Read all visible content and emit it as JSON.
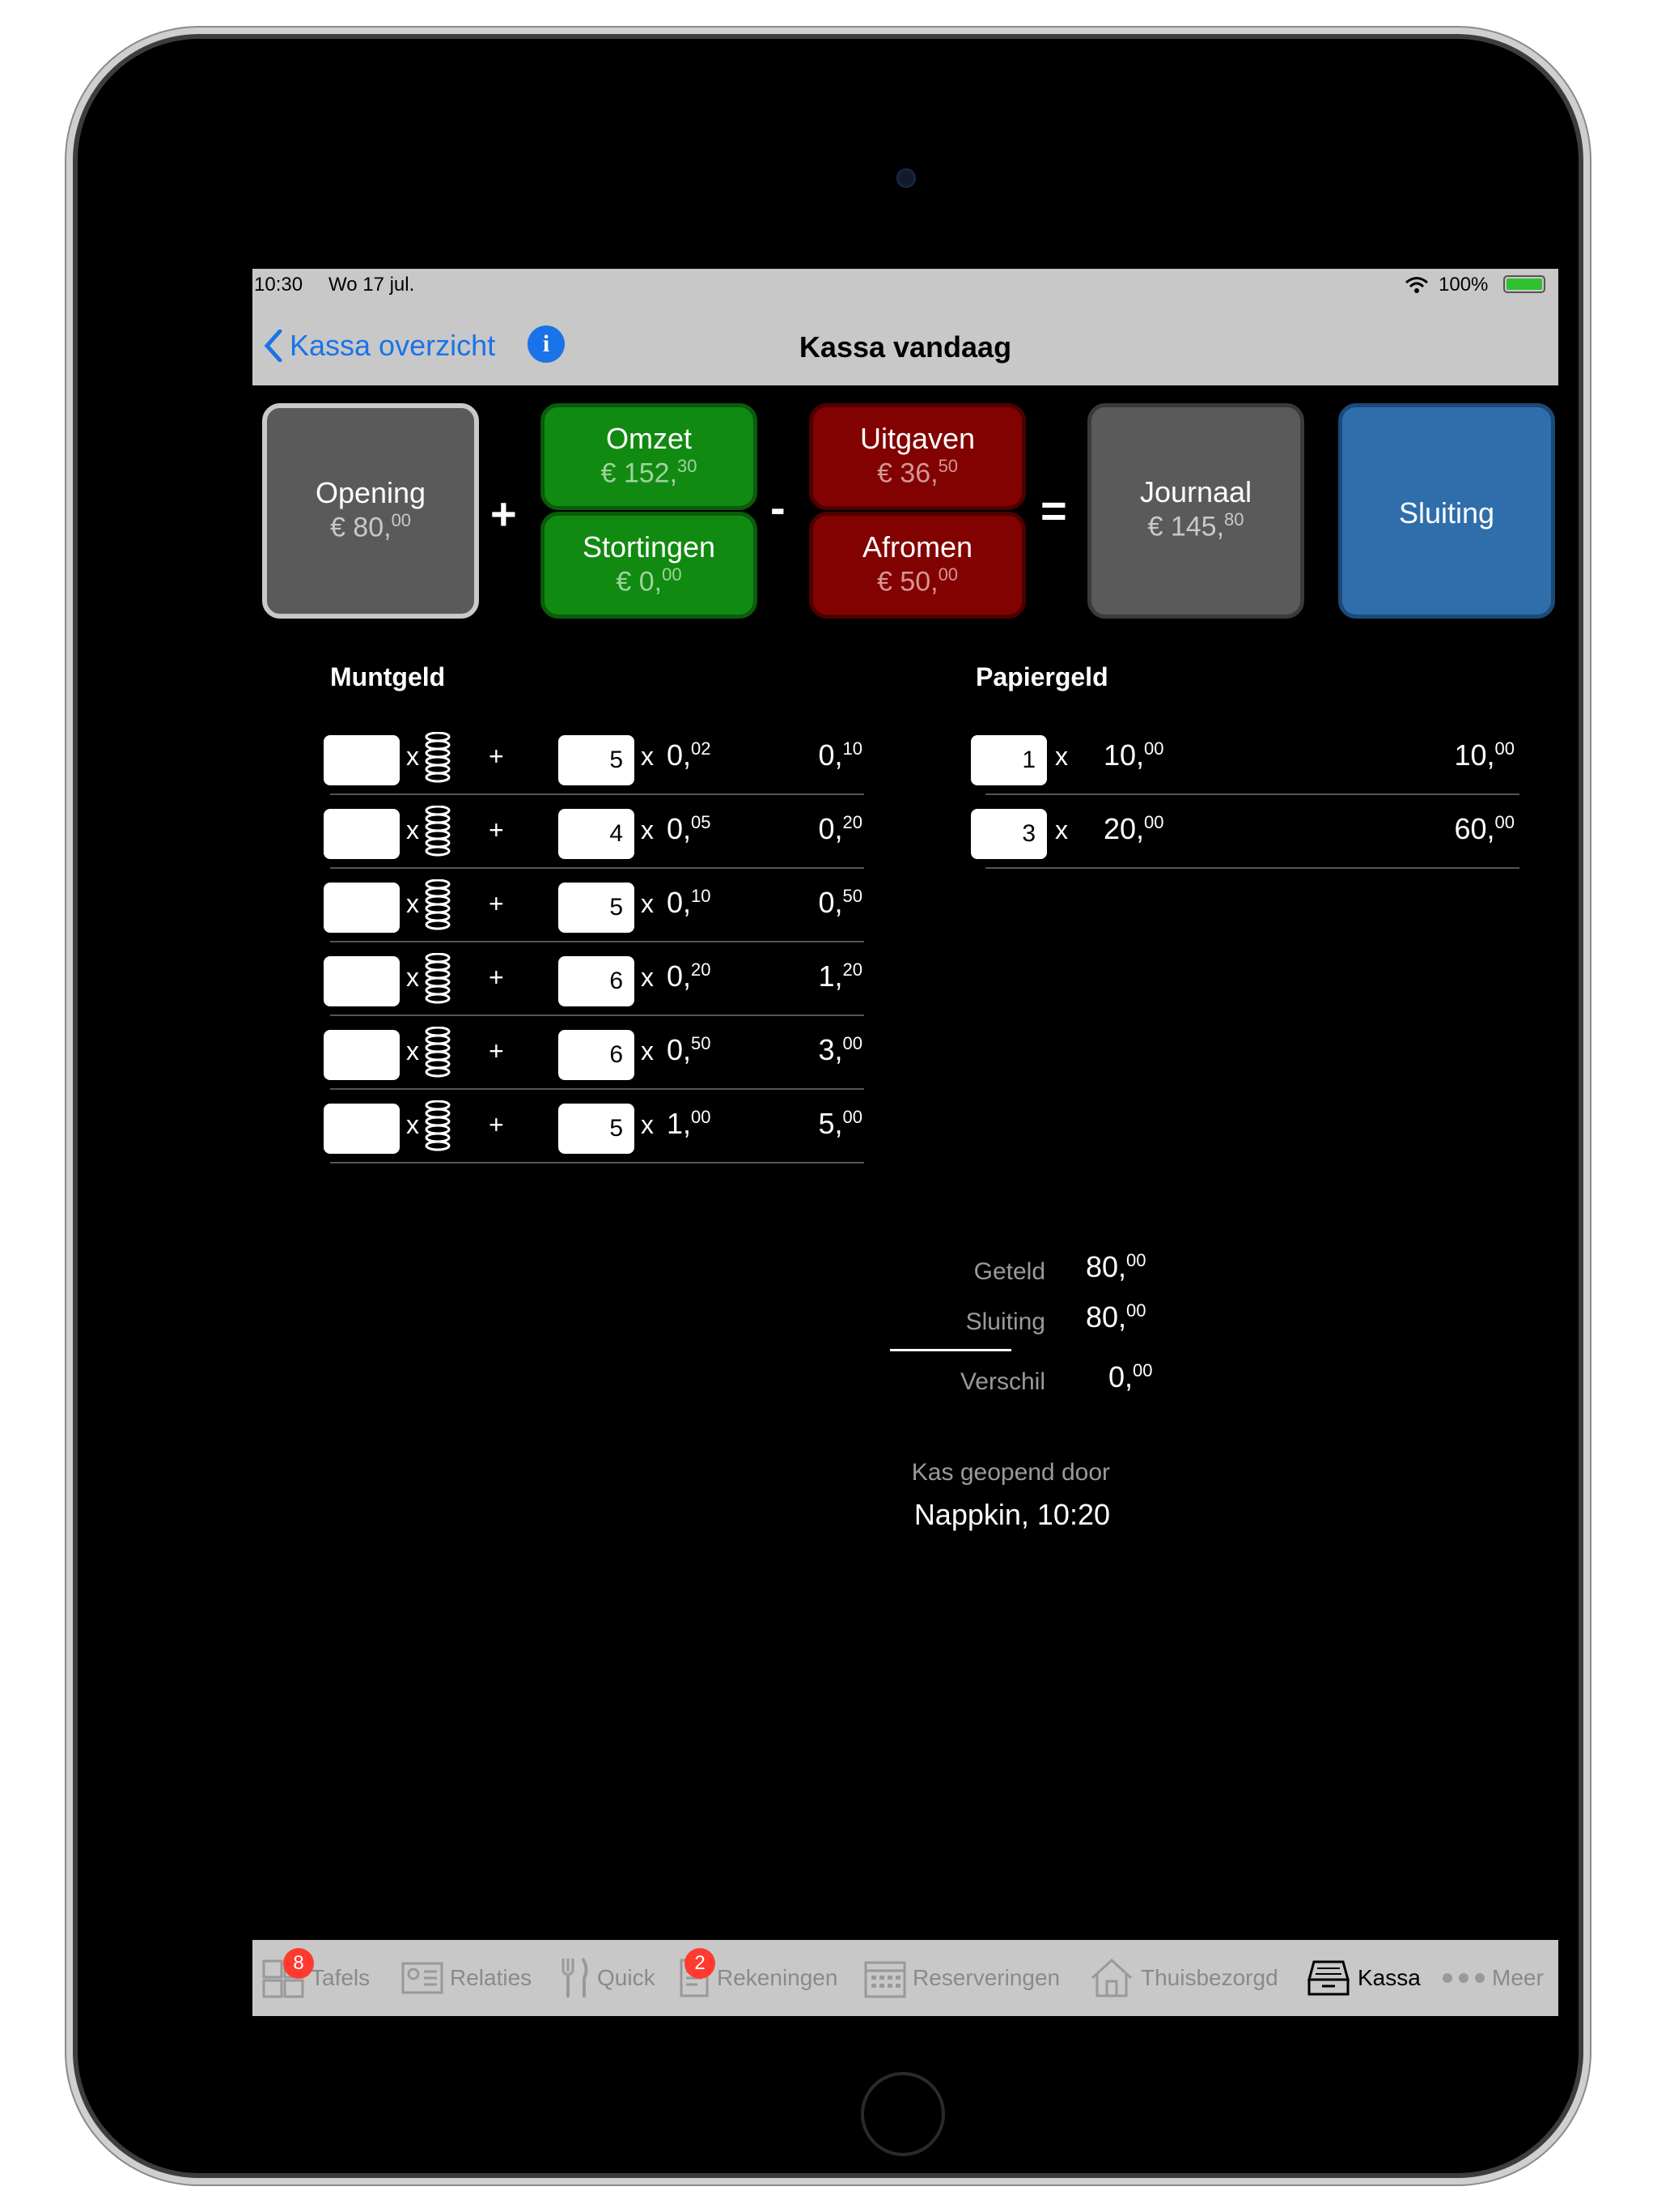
{
  "status": {
    "time": "10:30",
    "date": "Wo 17 jul.",
    "battery": "100%"
  },
  "nav": {
    "back_label": "Kassa overzicht",
    "info_label": "i",
    "title": "Kassa vandaag"
  },
  "summary_tiles": {
    "opening": {
      "label": "Opening",
      "main": "€ 80,",
      "cents": "00"
    },
    "omzet": {
      "label": "Omzet",
      "main": "€ 152,",
      "cents": "30"
    },
    "stortingen": {
      "label": "Stortingen",
      "main": "€ 0,",
      "cents": "00"
    },
    "uitgaven": {
      "label": "Uitgaven",
      "main": "€ 36,",
      "cents": "50"
    },
    "afromen": {
      "label": "Afromen",
      "main": "€ 50,",
      "cents": "00"
    },
    "journaal": {
      "label": "Journaal",
      "main": "€ 145,",
      "cents": "80"
    },
    "sluiting": {
      "label": "Sluiting"
    },
    "ops": {
      "plus": "+",
      "minus": "-",
      "equals": "="
    }
  },
  "muntgeld": {
    "title": "Muntgeld",
    "x": "x",
    "plus": "+",
    "rows": [
      {
        "count": "5",
        "denom_main": "0,",
        "denom_cents": "02",
        "total_main": "0,",
        "total_cents": "10"
      },
      {
        "count": "4",
        "denom_main": "0,",
        "denom_cents": "05",
        "total_main": "0,",
        "total_cents": "20"
      },
      {
        "count": "5",
        "denom_main": "0,",
        "denom_cents": "10",
        "total_main": "0,",
        "total_cents": "50"
      },
      {
        "count": "6",
        "denom_main": "0,",
        "denom_cents": "20",
        "total_main": "1,",
        "total_cents": "20"
      },
      {
        "count": "6",
        "denom_main": "0,",
        "denom_cents": "50",
        "total_main": "3,",
        "total_cents": "00"
      },
      {
        "count": "5",
        "denom_main": "1,",
        "denom_cents": "00",
        "total_main": "5,",
        "total_cents": "00"
      }
    ]
  },
  "papiergeld": {
    "title": "Papiergeld",
    "x": "x",
    "rows": [
      {
        "count": "1",
        "denom_main": "10,",
        "denom_cents": "00",
        "total_main": "10,",
        "total_cents": "00"
      },
      {
        "count": "3",
        "denom_main": "20,",
        "denom_cents": "00",
        "total_main": "60,",
        "total_cents": "00"
      }
    ]
  },
  "totals": {
    "geteld_label": "Geteld",
    "geteld_main": "80,",
    "geteld_cents": "00",
    "sluiting_label": "Sluiting",
    "sluiting_main": "80,",
    "sluiting_cents": "00",
    "verschil_label": "Verschil",
    "verschil_main": "0,",
    "verschil_cents": "00"
  },
  "opened_by": {
    "label": "Kas geopend door",
    "value": "Nappkin,  10:20"
  },
  "tabs": [
    {
      "label": "Tafels",
      "badge": "8"
    },
    {
      "label": "Relaties"
    },
    {
      "label": "Quick"
    },
    {
      "label": "Rekeningen",
      "badge": "2"
    },
    {
      "label": "Reserveringen"
    },
    {
      "label": "Thuisbezorgd"
    },
    {
      "label": "Kassa"
    },
    {
      "label": "Meer"
    }
  ]
}
